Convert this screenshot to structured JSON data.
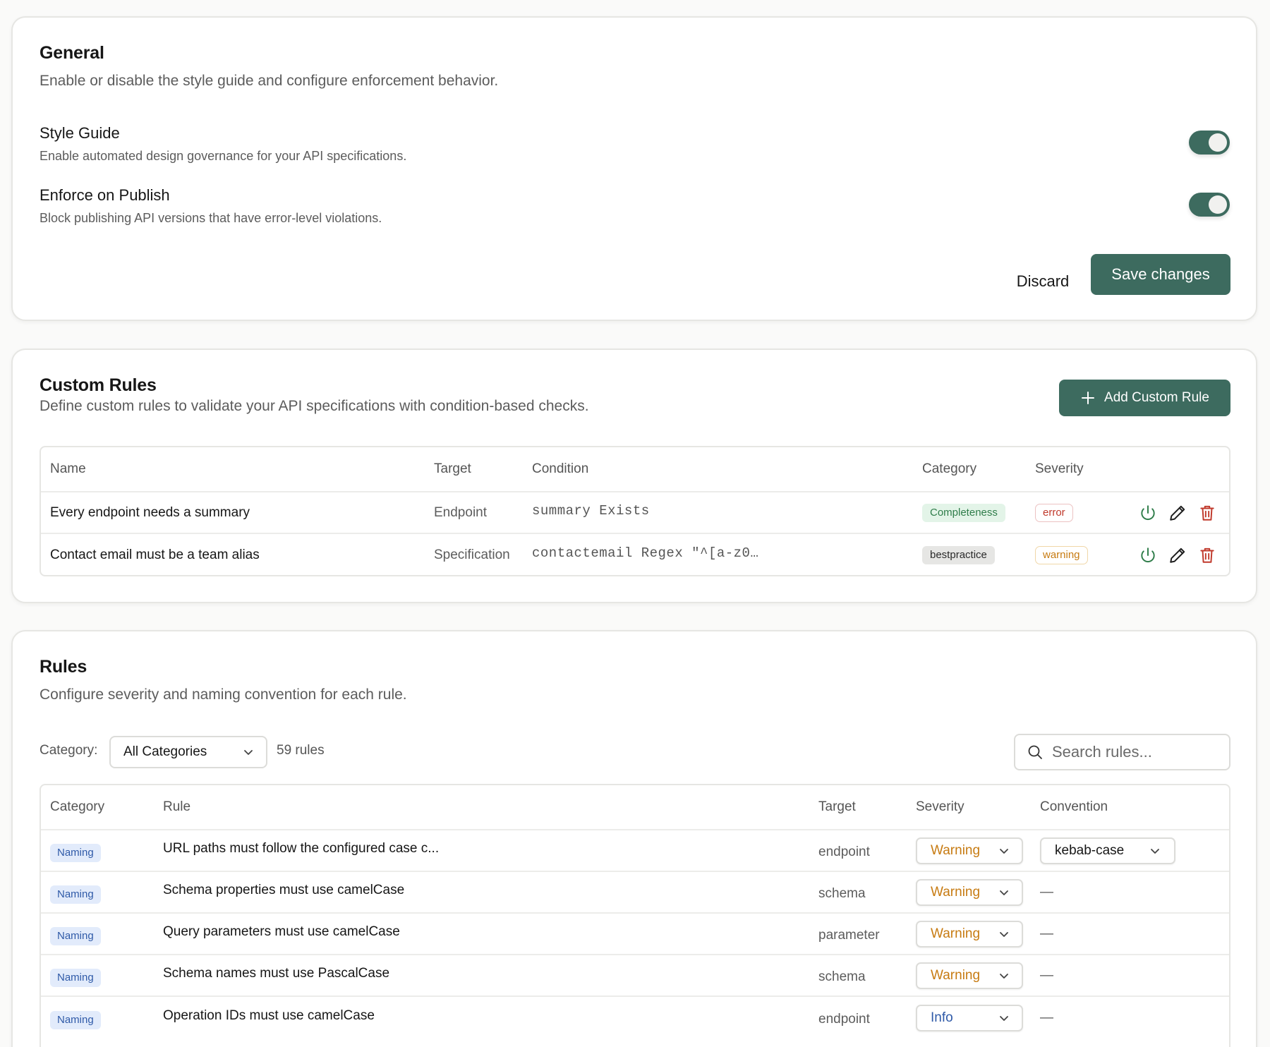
{
  "general": {
    "title": "General",
    "subtitle": "Enable or disable the style guide and configure enforcement behavior.",
    "settings": [
      {
        "title": "Style Guide",
        "description": "Enable automated design governance for your API specifications.",
        "enabled": true
      },
      {
        "title": "Enforce on Publish",
        "description": "Block publishing API versions that have error-level violations.",
        "enabled": true
      }
    ],
    "discard_label": "Discard",
    "save_label": "Save changes"
  },
  "custom_rules": {
    "title": "Custom Rules",
    "subtitle": "Define custom rules to validate your API specifications with condition-based checks.",
    "add_label": "Add Custom Rule",
    "columns": {
      "name": "Name",
      "target": "Target",
      "condition": "Condition",
      "category": "Category",
      "severity": "Severity"
    },
    "rows": [
      {
        "name": "Every endpoint needs a summary",
        "target": "Endpoint",
        "condition": "summary Exists",
        "category": "Completeness",
        "severity": "error"
      },
      {
        "name": "Contact email must be a team alias",
        "target": "Specification",
        "condition": "contactemail Regex \"^[a-z0…",
        "category": "bestpractice",
        "severity": "warning"
      }
    ]
  },
  "rules": {
    "title": "Rules",
    "subtitle": "Configure severity and naming convention for each rule.",
    "filter_label": "Category:",
    "category_selected": "All Categories",
    "count_label": "59 rules",
    "search_placeholder": "Search rules...",
    "columns": {
      "category": "Category",
      "rule": "Rule",
      "target": "Target",
      "severity": "Severity",
      "convention": "Convention"
    },
    "rows": [
      {
        "category": "Naming",
        "rule": "URL paths must follow the configured case c...",
        "target": "endpoint",
        "severity": "Warning",
        "convention": "kebab-case"
      },
      {
        "category": "Naming",
        "rule": "Schema properties must use camelCase",
        "target": "schema",
        "severity": "Warning",
        "convention": "—"
      },
      {
        "category": "Naming",
        "rule": "Query parameters must use camelCase",
        "target": "parameter",
        "severity": "Warning",
        "convention": "—"
      },
      {
        "category": "Naming",
        "rule": "Schema names must use PascalCase",
        "target": "schema",
        "severity": "Warning",
        "convention": "—"
      },
      {
        "category": "Naming",
        "rule": "Operation IDs must use camelCase",
        "target": "endpoint",
        "severity": "Info",
        "convention": "—"
      }
    ]
  },
  "colors": {
    "accent": "#3d6b5f",
    "error": "#c0392b",
    "warning": "#c77b12",
    "info": "#2f5aa8",
    "success": "#2f7d4a"
  },
  "icons": {
    "power": "power-icon",
    "edit": "pencil-icon",
    "delete": "trash-icon",
    "search": "search-icon",
    "chevron": "chevron-down-icon",
    "add": "plus-icon"
  }
}
